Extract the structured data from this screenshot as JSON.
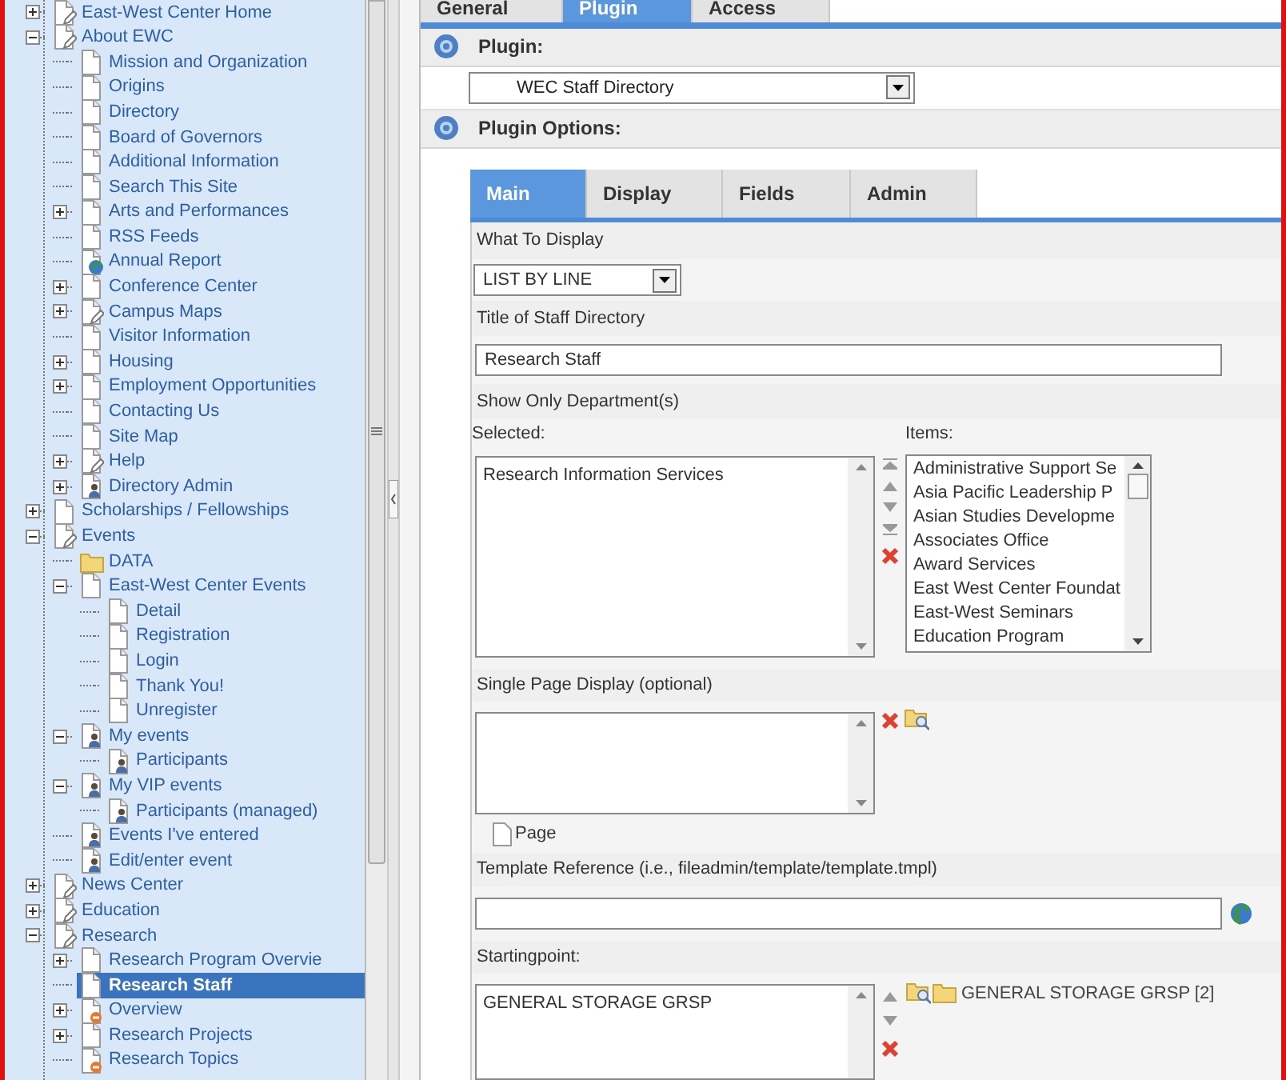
{
  "page_tree": {
    "items": [
      {
        "label": "East-West Center Home",
        "kind": "page-edit",
        "expanded": false,
        "selected": false
      },
      {
        "label": "About EWC",
        "kind": "page-edit",
        "expanded": true,
        "selected": false,
        "children": [
          {
            "label": "Mission and Organization",
            "kind": "page",
            "selected": false
          },
          {
            "label": "Origins",
            "kind": "page",
            "selected": false
          },
          {
            "label": "Directory",
            "kind": "page",
            "selected": false
          },
          {
            "label": "Board of Governors",
            "kind": "page",
            "selected": false
          },
          {
            "label": "Additional Information",
            "kind": "page",
            "selected": false
          },
          {
            "label": "Search This Site",
            "kind": "page",
            "selected": false
          },
          {
            "label": "Arts and Performances",
            "kind": "page",
            "expanded": false,
            "selected": false
          },
          {
            "label": "RSS Feeds",
            "kind": "page",
            "selected": false
          },
          {
            "label": "Annual Report",
            "kind": "globe",
            "selected": false
          },
          {
            "label": "Conference Center",
            "kind": "page",
            "expanded": false,
            "selected": false
          },
          {
            "label": "Campus Maps",
            "kind": "page-edit",
            "expanded": false,
            "selected": false
          },
          {
            "label": "Visitor Information",
            "kind": "page",
            "selected": false
          },
          {
            "label": "Housing",
            "kind": "page",
            "expanded": false,
            "selected": false
          },
          {
            "label": "Employment Opportunities",
            "kind": "page",
            "expanded": false,
            "selected": false
          },
          {
            "label": "Contacting Us",
            "kind": "page",
            "selected": false
          },
          {
            "label": "Site Map",
            "kind": "page",
            "selected": false
          },
          {
            "label": "Help",
            "kind": "page-edit",
            "expanded": false,
            "selected": false
          },
          {
            "label": "Directory Admin",
            "kind": "user",
            "expanded": false,
            "selected": false
          }
        ]
      },
      {
        "label": "Scholarships / Fellowships",
        "kind": "page",
        "expanded": false,
        "selected": false
      },
      {
        "label": "Events",
        "kind": "page-edit",
        "expanded": true,
        "selected": false,
        "children": [
          {
            "label": "DATA",
            "kind": "folder",
            "selected": false
          },
          {
            "label": "East-West Center Events",
            "kind": "page",
            "expanded": true,
            "selected": false,
            "children": [
              {
                "label": "Detail",
                "kind": "page",
                "selected": false
              },
              {
                "label": "Registration",
                "kind": "page",
                "selected": false
              },
              {
                "label": "Login",
                "kind": "page",
                "selected": false
              },
              {
                "label": "Thank You!",
                "kind": "page",
                "selected": false
              },
              {
                "label": "Unregister",
                "kind": "page",
                "selected": false
              }
            ]
          },
          {
            "label": "My events",
            "kind": "user",
            "expanded": true,
            "selected": false,
            "children": [
              {
                "label": "Participants",
                "kind": "user",
                "selected": false
              }
            ]
          },
          {
            "label": "My VIP events",
            "kind": "user",
            "expanded": true,
            "selected": false,
            "children": [
              {
                "label": "Participants (managed)",
                "kind": "user",
                "selected": false
              }
            ]
          },
          {
            "label": "Events I've entered",
            "kind": "user",
            "selected": false
          },
          {
            "label": "Edit/enter event",
            "kind": "user",
            "selected": false
          }
        ]
      },
      {
        "label": "News Center",
        "kind": "page-edit",
        "expanded": false,
        "selected": false
      },
      {
        "label": "Education",
        "kind": "page-edit",
        "expanded": false,
        "selected": false
      },
      {
        "label": "Research",
        "kind": "page-edit",
        "expanded": true,
        "selected": false,
        "children": [
          {
            "label": "Research Program Overvie",
            "kind": "page",
            "expanded": false,
            "selected": false
          },
          {
            "label": "Research Staff",
            "kind": "page",
            "selected": true
          },
          {
            "label": "Overview",
            "kind": "hidden",
            "expanded": false,
            "selected": false
          },
          {
            "label": "Research Projects",
            "kind": "page",
            "expanded": false,
            "selected": false
          },
          {
            "label": "Research Topics",
            "kind": "hidden",
            "selected": false
          }
        ]
      }
    ]
  },
  "record_tabs": [
    {
      "label": "General",
      "selected": false
    },
    {
      "label": "Plugin",
      "selected": true
    },
    {
      "label": "Access",
      "selected": false
    }
  ],
  "plugin_section": {
    "title": "Plugin:",
    "plugin_select": {
      "value": "WEC Staff Directory"
    }
  },
  "plugin_options": {
    "title": "Plugin Options:",
    "tabs": [
      {
        "label": "Main",
        "selected": true
      },
      {
        "label": "Display",
        "selected": false
      },
      {
        "label": "Fields",
        "selected": false
      },
      {
        "label": "Admin",
        "selected": false
      }
    ],
    "what_to_display": {
      "label": "What To Display",
      "value": "LIST BY LINE"
    },
    "title_field": {
      "label": "Title of Staff Directory",
      "value": "Research Staff"
    },
    "departments": {
      "label": "Show Only Department(s)",
      "selected_label": "Selected:",
      "selected_items": [
        "Research Information Services"
      ],
      "items_label": "Items:",
      "items": [
        "Administrative Support Se",
        "Asia Pacific Leadership P",
        "Asian Studies Developme",
        "Associates Office",
        "Award Services",
        "East West Center Foundat",
        "East-West Seminars",
        "Education Program"
      ]
    },
    "single_page": {
      "label": "Single Page Display (optional)",
      "record_type": "Page"
    },
    "template": {
      "label": "Template Reference (i.e., fileadmin/template/template.tmpl)"
    },
    "startingpoint": {
      "label": "Startingpoint:",
      "selected_items": [
        "GENERAL STORAGE GRSP"
      ],
      "browse_result": "GENERAL STORAGE GRSP [2]"
    }
  }
}
